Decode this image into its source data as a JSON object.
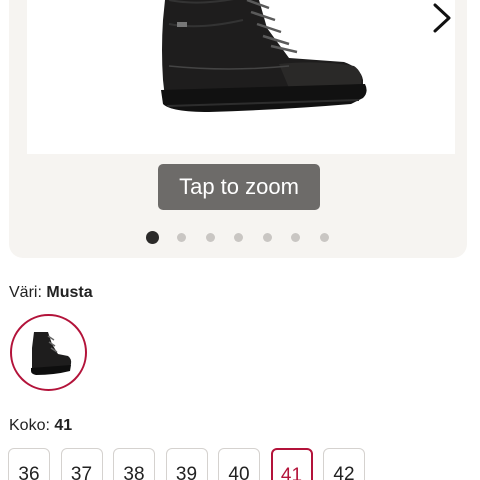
{
  "gallery": {
    "zoom_label": "Tap to zoom",
    "next_icon": "chevron-right-icon",
    "dots_total": 7,
    "active_dot": 1
  },
  "color": {
    "label": "Väri:",
    "value": "Musta"
  },
  "size": {
    "label": "Koko:",
    "value": "41",
    "options": [
      "36",
      "37",
      "38",
      "39",
      "40",
      "41",
      "42"
    ],
    "selected": "41"
  },
  "theme": {
    "accent": "#b3133a",
    "zoom_button_bg": "#6d6b69",
    "card_bg": "#f6f4f1"
  }
}
